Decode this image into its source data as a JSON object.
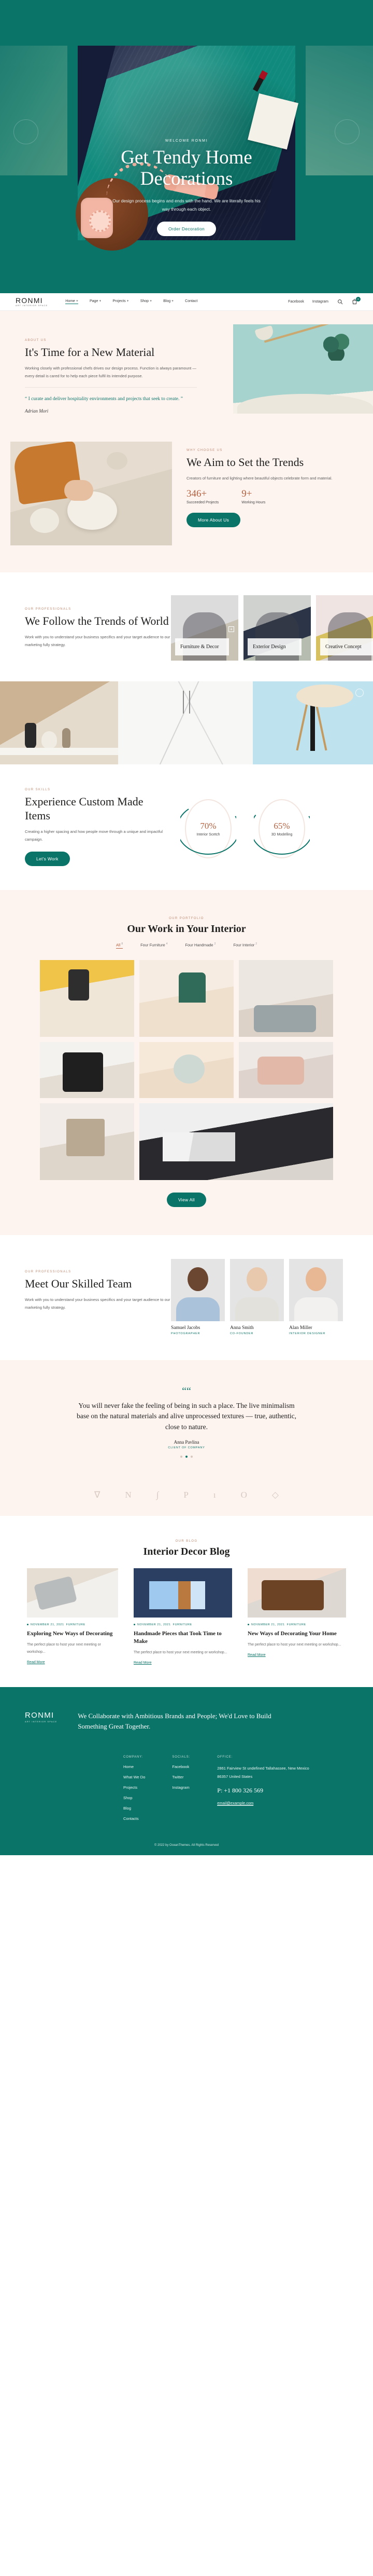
{
  "hero": {
    "eyebrow": "WELCOME RONMI",
    "title_line1": "Get Tendy Home",
    "title_line2": "Decorations",
    "subtitle": "Our design process begins and ends with the hand. We are literally feels his way through each object.",
    "cta": "Order Decoration"
  },
  "nav": {
    "logo": "RONMI",
    "logo_sub": "ART INTERIOR SPACE",
    "items": [
      {
        "label": "Home +",
        "active": true
      },
      {
        "label": "Page +",
        "active": false
      },
      {
        "label": "Projects +",
        "active": false
      },
      {
        "label": "Shop +",
        "active": false
      },
      {
        "label": "Blog +",
        "active": false
      },
      {
        "label": "Contact",
        "active": false
      }
    ],
    "socials": [
      "Facebook",
      "Instagram"
    ],
    "cart_count": "0"
  },
  "about": {
    "eyebrow": "ABOUT US",
    "title": "It's Time for a New Material",
    "body": "Working closely with professional chefs drives our design process. Function is always paramount — every detail is cared for to help each piece fulfil its intended purpose.",
    "quote": "“ I curate and deliver hospitality environments and projects that seek to create. ”",
    "signature": "Adrian Mori"
  },
  "trends": {
    "eyebrow": "WHY CHOOSE US",
    "title": "We Aim to Set the Trends",
    "body": "Creators of furniture and lighting where beautiful objects celebrate form and material.",
    "stats": [
      {
        "value": "346+",
        "label": "Succeeded Projects"
      },
      {
        "value": "9+",
        "label": "Working Hours"
      }
    ],
    "cta": "More About Us"
  },
  "professionals": {
    "eyebrow": "OUR PROFESSIONALS",
    "title": "We Follow the Trends of World",
    "body": "Work with you to understand your business specifics and your target audience to our marketing fully strategy.",
    "cards": [
      {
        "title": "Furniture & Decor"
      },
      {
        "title": "Exterior Design"
      },
      {
        "title": "Creative Concept"
      }
    ]
  },
  "skills": {
    "eyebrow": "OUR SKILLS",
    "title": "Experience Custom Made Items",
    "body": "Creating a higher spacing and how people move through a unique and impactful campaign.",
    "cta": "Let's Work",
    "donuts": [
      {
        "value": "70%",
        "label": "Interior Scetch",
        "percent": 70
      },
      {
        "value": "65%",
        "label": "3D Modelling",
        "percent": 65
      }
    ]
  },
  "portfolio": {
    "eyebrow": "OUR PORTFOLIO",
    "title": "Our Work in Your Interior",
    "filters": [
      {
        "label": "All",
        "count": "8",
        "active": true
      },
      {
        "label": "Four Furniture",
        "count": "4",
        "active": false
      },
      {
        "label": "Four Handmade",
        "count": "2",
        "active": false
      },
      {
        "label": "Four Interior",
        "count": "2",
        "active": false
      }
    ],
    "cta": "View All"
  },
  "team": {
    "eyebrow": "OUR PROFESSIONALS",
    "title": "Meet Our Skilled Team",
    "body": "Work with you to understand your business specifics and your target audience to our marketing fully strategy.",
    "members": [
      {
        "name": "Samuel Jacobs",
        "role": "PHOTOGRAPHER"
      },
      {
        "name": "Anna Smith",
        "role": "CO-FOUNDER"
      },
      {
        "name": "Alan Miller",
        "role": "INTERIOR DESIGNER"
      }
    ]
  },
  "testimonial": {
    "mark": "““",
    "quote": "You will never fake the feeling of being in such a place. The live minimalism base on the natural materials and alive unprocessed textures — true, authentic, close to nature.",
    "name": "Anna Pavlina",
    "role": "CLIENT OF COMPANY"
  },
  "brands": [
    "∇",
    "N",
    "∫",
    "P",
    "ı",
    "O",
    "◇"
  ],
  "blog": {
    "eyebrow": "OUR BLOG",
    "title": "Interior Decor Blog",
    "posts": [
      {
        "date": "NOVEMBER 21, 2021",
        "category": "FURNITURE",
        "title": "Exploring New Ways of Decorating",
        "excerpt": "The perfect place to host your next meeting or workshop...",
        "read_more": "Read More"
      },
      {
        "date": "NOVEMBER 21, 2021",
        "category": "FURNITURE",
        "title": "Handmade Pieces that Took Time to Make",
        "excerpt": "The perfect place to host your next meeting or workshop...",
        "read_more": "Read More"
      },
      {
        "date": "NOVEMBER 21, 2021",
        "category": "FURNITURE",
        "title": "New Ways of Decorating Your Home",
        "excerpt": "The perfect place to host your next meeting or workshop...",
        "read_more": "Read More"
      }
    ]
  },
  "footer": {
    "logo": "RONMI",
    "logo_sub": "ART INTERIOR SPACE",
    "headline": "We Collaborate with Ambitious Brands and People; We'd Love to Build Something Great Together.",
    "company_title": "COMPANY:",
    "company_links": [
      "Home",
      "What We Do",
      "Projects",
      "Shop",
      "Blog",
      "Contacts"
    ],
    "socials_title": "SOCIALS:",
    "socials_links": [
      "Facebook",
      "Twitter",
      "Instagram"
    ],
    "office_title": "OFFICE:",
    "address": "2861 Fairview St undefined Tallahassee, New Mexico 86357 United States",
    "phone": "P: +1 800 326 569",
    "email": "email@example.com",
    "copyright": "© 2022 by OceanThemes. All Rights Reserved"
  },
  "colors": {
    "brand_green": "#0b7468",
    "cream": "#fdf4f0",
    "accent_copper": "#b5613f"
  }
}
